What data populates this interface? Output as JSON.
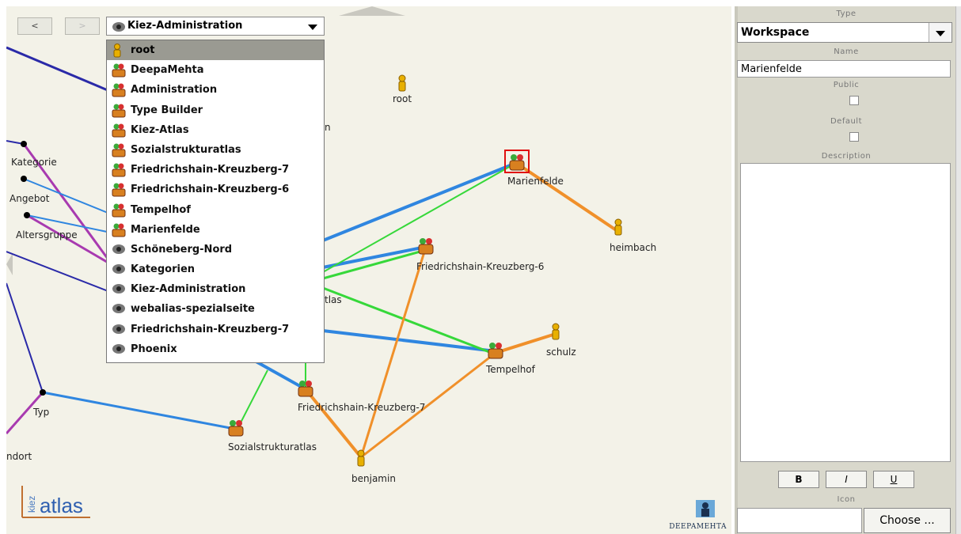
{
  "toolbar": {
    "back_label": "<",
    "forward_label": ">"
  },
  "workspace_combo": {
    "selected": "Kiez-Administration",
    "icon": "eye-icon"
  },
  "workspace_menu": [
    {
      "label": "root",
      "icon": "user-icon"
    },
    {
      "label": "DeepaMehta",
      "icon": "group-icon"
    },
    {
      "label": "Administration",
      "icon": "group-icon"
    },
    {
      "label": "Type Builder",
      "icon": "group-icon"
    },
    {
      "label": "Kiez-Atlas",
      "icon": "group-icon"
    },
    {
      "label": "Sozialstrukturatlas",
      "icon": "group-icon"
    },
    {
      "label": "Friedrichshain-Kreuzberg-7",
      "icon": "group-icon"
    },
    {
      "label": "Friedrichshain-Kreuzberg-6",
      "icon": "group-icon"
    },
    {
      "label": "Tempelhof",
      "icon": "group-icon"
    },
    {
      "label": "Marienfelde",
      "icon": "group-icon"
    },
    {
      "label": "Schöneberg-Nord",
      "icon": "eye-icon"
    },
    {
      "label": "Kategorien",
      "icon": "eye-icon"
    },
    {
      "label": "Kiez-Administration",
      "icon": "eye-icon"
    },
    {
      "label": "webalias-spezialseite",
      "icon": "eye-icon"
    },
    {
      "label": "Friedrichshain-Kreuzberg-7",
      "icon": "eye-icon"
    },
    {
      "label": "Phoenix",
      "icon": "eye-icon"
    }
  ],
  "graph_labels": {
    "root": "root",
    "marienfelde": "Marienfelde",
    "heimbach": "heimbach",
    "fk6": "Friedrichshain-Kreuzberg-6",
    "schulz": "schulz",
    "tempelhof": "Tempelhof",
    "fk7": "Friedrichshain-Kreuzberg-7",
    "sozial": "Sozialstrukturatlas",
    "benjamin": "benjamin",
    "kategorie": "Kategorie",
    "angebot": "Angebot",
    "altersgruppe": "Altersgruppe",
    "typ": "Typ",
    "standort": "ndort",
    "partial_atlas": "tlas",
    "partial_n": "n"
  },
  "colors": {
    "blue_edge": "#2f86e0",
    "green_edge": "#36d83a",
    "orange_edge": "#f0902a",
    "purple_edge": "#a83ab0",
    "navy_edge": "#2a2aa8",
    "selection": "#e01010"
  },
  "logos": {
    "kiez_small": "kiez",
    "kiez_big": "atlas",
    "deepamehta": "DeepaMehta"
  },
  "panel": {
    "type_label": "Type",
    "type_value": "Workspace",
    "name_label": "Name",
    "name_value": "Marienfelde",
    "public_label": "Public",
    "public_checked": false,
    "default_label": "Default",
    "default_checked": false,
    "description_label": "Description",
    "bold_label": "B",
    "italic_label": "I",
    "underline_label": "U",
    "icon_label": "Icon",
    "choose_label": "Choose ..."
  }
}
